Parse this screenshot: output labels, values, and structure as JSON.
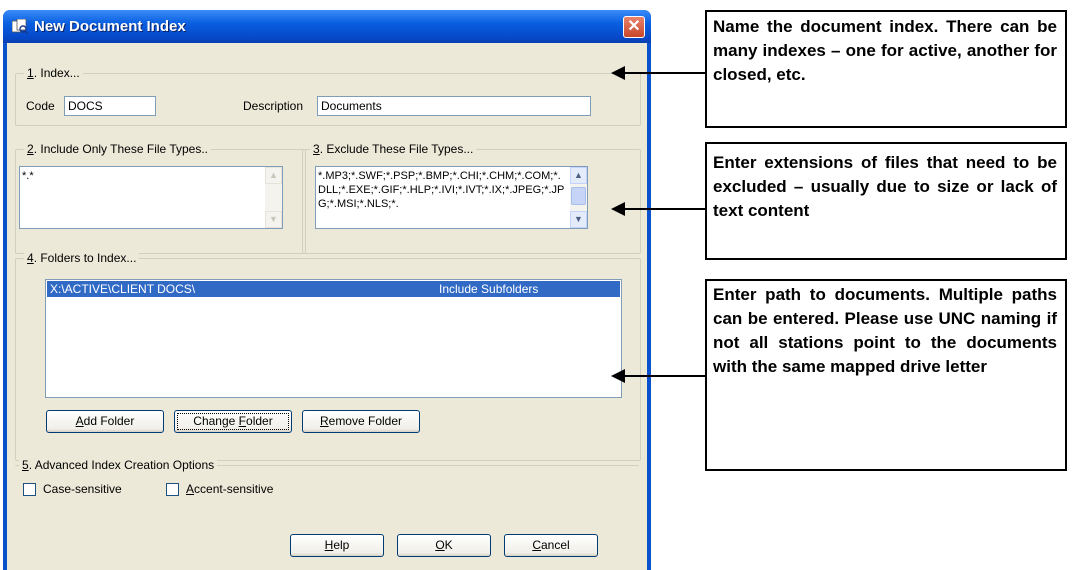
{
  "dialog": {
    "title": "New Document Index",
    "close_glyph": "✕",
    "index_group": {
      "num": "1",
      "rest": ". Index...",
      "code_label": "Code",
      "code_value": "DOCS",
      "description_label": "Description",
      "description_value": "Documents"
    },
    "include_group": {
      "num": "2",
      "rest": ". Include Only These File Types..",
      "value": "*.*"
    },
    "exclude_group": {
      "num": "3",
      "rest": ". Exclude These File Types...",
      "value": "*.MP3;*.SWF;*.PSP;*.BMP;*.CHI;*.CHM;*.COM;*.DLL;*.EXE;*.GIF;*.HLP;*.IVI;*.IVT;*.IX;*.JPEG;*.JPG;*.MSI;*.NLS;*."
    },
    "folders_group": {
      "num": "4",
      "rest": ". Folders to Index...",
      "rows": [
        {
          "path": "X:\\ACTIVE\\CLIENT DOCS\\",
          "option": "Include Subfolders"
        }
      ],
      "add_button": {
        "key": "A",
        "rest": "dd Folder"
      },
      "change_button": {
        "pre": "Change ",
        "key": "F",
        "rest": "older"
      },
      "remove_button": {
        "key": "R",
        "rest": "emove Folder"
      }
    },
    "advanced_group": {
      "num": "5",
      "rest": ". Advanced Index Creation Options",
      "case_label": "Case-sensitive",
      "accent": {
        "key": "A",
        "rest": "ccent-sensitive"
      }
    },
    "help_button": {
      "key": "H",
      "rest": "elp"
    },
    "ok_button": {
      "key": "O",
      "rest": "K"
    },
    "cancel_button": {
      "key": "C",
      "rest": "ancel"
    }
  },
  "callouts": [
    {
      "text": "Name the document index. There can be many indexes – one for active, another for closed, etc."
    },
    {
      "text": "Enter extensions of files that need to be excluded – usually due to size or lack of text content"
    },
    {
      "text": "Enter path to documents. Multiple paths can be entered. Please use UNC naming if not all stations point to the documents with the same mapped drive letter"
    }
  ],
  "colors": {
    "titlebar": "#0a5fe0",
    "dialog_face": "#ece9d8",
    "selection": "#316ac5",
    "close_button": "#d9573c"
  }
}
